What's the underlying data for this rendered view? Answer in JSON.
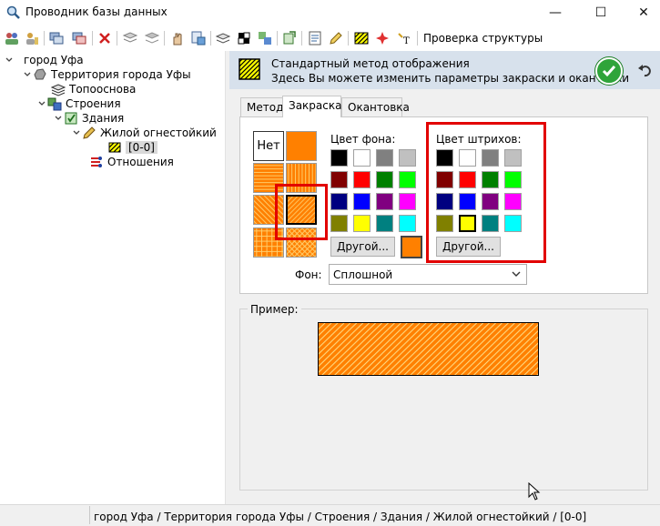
{
  "window": {
    "title": "Проводник базы данных",
    "minimize": "—",
    "maximize": "☐",
    "close": "✕"
  },
  "toolbar": {
    "check_structure": "Проверка структуры"
  },
  "tree": {
    "root": "город Уфа",
    "territory": "Территория города Уфы",
    "topo": "Топооснова",
    "buildings_group": "Строения",
    "buildings": "Здания",
    "residential": "Жилой огнестойкий",
    "item": "[0-0]",
    "relations": "Отношения"
  },
  "header": {
    "line1": "Стандартный метод отображения",
    "line2": "Здесь Вы можете изменить параметры закраски и окантовки"
  },
  "tabs": [
    "Метод",
    "Закраска",
    "Окантовка"
  ],
  "fill": {
    "none_label": "Нет",
    "bgcolor_label": "Цвет фона:",
    "hatch_label": "Цвет штрихов:",
    "other_button": "Другой...",
    "fon_label": "Фон:",
    "fon_value": "Сплошной",
    "swatches": [
      "#000000",
      "#ffffff",
      "#808080",
      "#c0c0c0",
      "#800000",
      "#ff0000",
      "#008000",
      "#00ff00",
      "#000080",
      "#0000ff",
      "#800080",
      "#ff00ff",
      "#808000",
      "#ffff00",
      "#008080",
      "#00ffff"
    ],
    "current_bg": "#ff8000",
    "selected_hatch": "#ffff00"
  },
  "preview": {
    "label": "Пример:"
  },
  "status": {
    "path": "город Уфа / Территория города Уфы / Строения / Здания / Жилой огнестойкий / [0-0]"
  },
  "colors": {
    "accent_red": "#e20000",
    "orange": "#ff8000",
    "ok_green": "#2fa43a",
    "header_bg": "#d7e1ec"
  }
}
